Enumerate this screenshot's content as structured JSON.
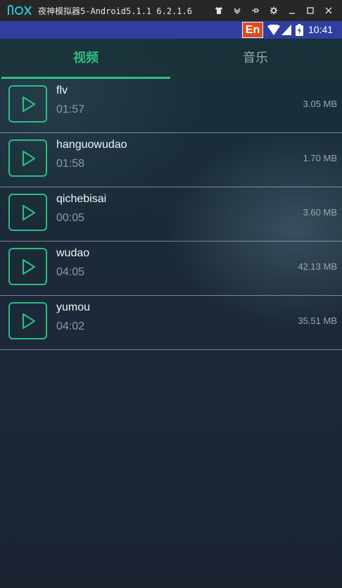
{
  "window": {
    "title": "夜神模拟器5-Android5.1.1 6.2.1.6",
    "controls": [
      "shirt-icon",
      "chevron-down-icon",
      "pin-icon",
      "gear-icon",
      "minimize-icon",
      "maximize-icon",
      "close-icon"
    ]
  },
  "statusbar": {
    "ime_label": "En",
    "time": "10:41"
  },
  "tabs": [
    {
      "label": "视频",
      "active": true
    },
    {
      "label": "音乐",
      "active": false
    }
  ],
  "items": [
    {
      "name": "flv",
      "duration": "01:57",
      "size": "3.05 MB"
    },
    {
      "name": "hanguowudao",
      "duration": "01:58",
      "size": "1.70 MB"
    },
    {
      "name": "qichebisai",
      "duration": "00:05",
      "size": "3.60 MB"
    },
    {
      "name": "wudao",
      "duration": "04:05",
      "size": "42.13 MB"
    },
    {
      "name": "yumou",
      "duration": "04:02",
      "size": "35.51 MB"
    }
  ],
  "colors": {
    "accent": "#2fbf80",
    "status_bar": "#303f9f",
    "title_bar": "#272727"
  }
}
